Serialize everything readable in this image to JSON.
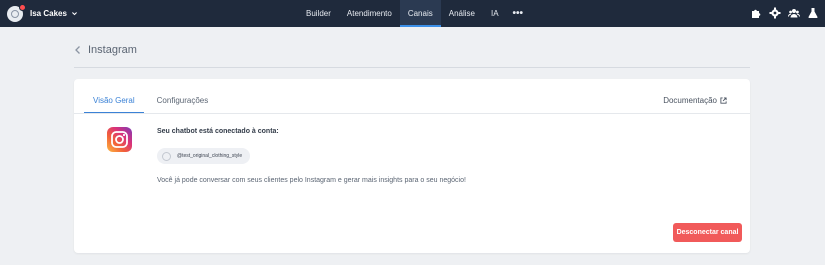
{
  "topbar": {
    "workspace_name": "Isa Cakes",
    "nav": [
      {
        "label": "Builder",
        "active": false
      },
      {
        "label": "Atendimento",
        "active": false
      },
      {
        "label": "Canais",
        "active": true
      },
      {
        "label": "Análise",
        "active": false
      },
      {
        "label": "IA",
        "active": false
      }
    ],
    "more_label": "•••",
    "tool_icons": [
      "puzzle-icon",
      "gear-icon",
      "team-icon",
      "flask-icon"
    ]
  },
  "page": {
    "title": "Instagram",
    "back_icon": "chevron-left-icon"
  },
  "card": {
    "tabs": [
      {
        "label": "Visão Geral",
        "active": true
      },
      {
        "label": "Configurações",
        "active": false
      }
    ],
    "doc_link": "Documentação",
    "connected_text": "Seu chatbot está conectado à conta:",
    "account_handle": "@test_original_clothing_style",
    "description": "Você já pode conversar com seus clientes pelo Instagram e gerar mais insights para o seu negócio!",
    "disconnect_label": "Desconectar canal"
  },
  "colors": {
    "topbar": "#1f2a3c",
    "accent": "#3b82d6",
    "danger": "#f15a5a",
    "background": "#eef0f3"
  }
}
